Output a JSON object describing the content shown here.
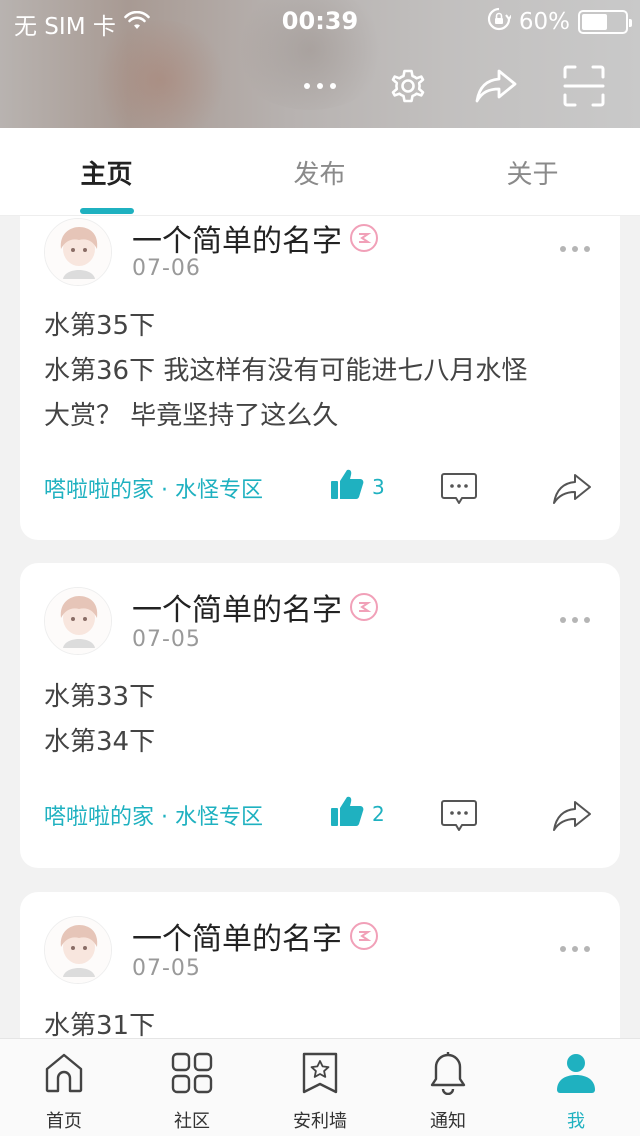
{
  "status_bar": {
    "carrier": "无 SIM 卡",
    "time": "00:39",
    "battery": "60%",
    "battery_level": 0.6
  },
  "tabs": [
    {
      "label": "主页",
      "active": true
    },
    {
      "label": "发布",
      "active": false
    },
    {
      "label": "关于",
      "active": false
    }
  ],
  "posts": [
    {
      "username": "一个简单的名字",
      "date": "07-06",
      "lines": [
        "水第35下",
        "水第36下 我这样有没有可能进七八月水怪",
        "大赏？ 毕竟坚持了这么久"
      ],
      "tags": "嗒啦啦的家 · 水怪专区",
      "likes": "3"
    },
    {
      "username": "一个简单的名字",
      "date": "07-05",
      "lines": [
        "水第33下",
        "水第34下"
      ],
      "tags": "嗒啦啦的家 · 水怪专区",
      "likes": "2"
    },
    {
      "username": "一个简单的名字",
      "date": "07-05",
      "lines": [
        "水第31下"
      ]
    }
  ],
  "bottom_nav": [
    {
      "label": "首页",
      "icon": "home-icon",
      "active": false
    },
    {
      "label": "社区",
      "icon": "grid-icon",
      "active": false
    },
    {
      "label": "安利墙",
      "icon": "bookmark-star-icon",
      "active": false
    },
    {
      "label": "通知",
      "icon": "bell-icon",
      "active": false
    },
    {
      "label": "我",
      "icon": "person-icon",
      "active": true
    }
  ],
  "colors": {
    "accent": "#1fb1c0",
    "badge": "#f1a0b8"
  }
}
